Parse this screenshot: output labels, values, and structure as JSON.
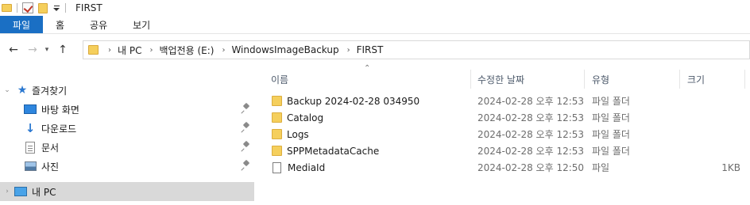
{
  "window": {
    "title": "FIRST"
  },
  "ribbon": {
    "tabs": [
      "파일",
      "홈",
      "공유",
      "보기"
    ]
  },
  "address": {
    "crumbs": [
      "내 PC",
      "백업전용 (E:)",
      "WindowsImageBackup",
      "FIRST"
    ]
  },
  "nav": {
    "quick_access": "즐겨찾기",
    "items": [
      {
        "label": "바탕 화면",
        "icon": "desktop-icon",
        "pinned": true
      },
      {
        "label": "다운로드",
        "icon": "download-icon",
        "pinned": true
      },
      {
        "label": "문서",
        "icon": "document-icon",
        "pinned": true
      },
      {
        "label": "사진",
        "icon": "pictures-icon",
        "pinned": true
      }
    ],
    "this_pc": "내 PC"
  },
  "columns": {
    "name": "이름",
    "date": "수정한 날짜",
    "type": "유형",
    "size": "크기"
  },
  "files": [
    {
      "name": "Backup 2024-02-28 034950",
      "date": "2024-02-28 오후 12:53",
      "type": "파일 폴더",
      "size": "",
      "kind": "folder"
    },
    {
      "name": "Catalog",
      "date": "2024-02-28 오후 12:53",
      "type": "파일 폴더",
      "size": "",
      "kind": "folder"
    },
    {
      "name": "Logs",
      "date": "2024-02-28 오후 12:53",
      "type": "파일 폴더",
      "size": "",
      "kind": "folder"
    },
    {
      "name": "SPPMetadataCache",
      "date": "2024-02-28 오후 12:53",
      "type": "파일 폴더",
      "size": "",
      "kind": "folder"
    },
    {
      "name": "MediaId",
      "date": "2024-02-28 오후 12:50",
      "type": "파일",
      "size": "1KB",
      "kind": "file"
    }
  ],
  "colors": {
    "accent": "#1a6fc4",
    "folder": "#f5cf5c",
    "selection": "#d9d9d9"
  }
}
